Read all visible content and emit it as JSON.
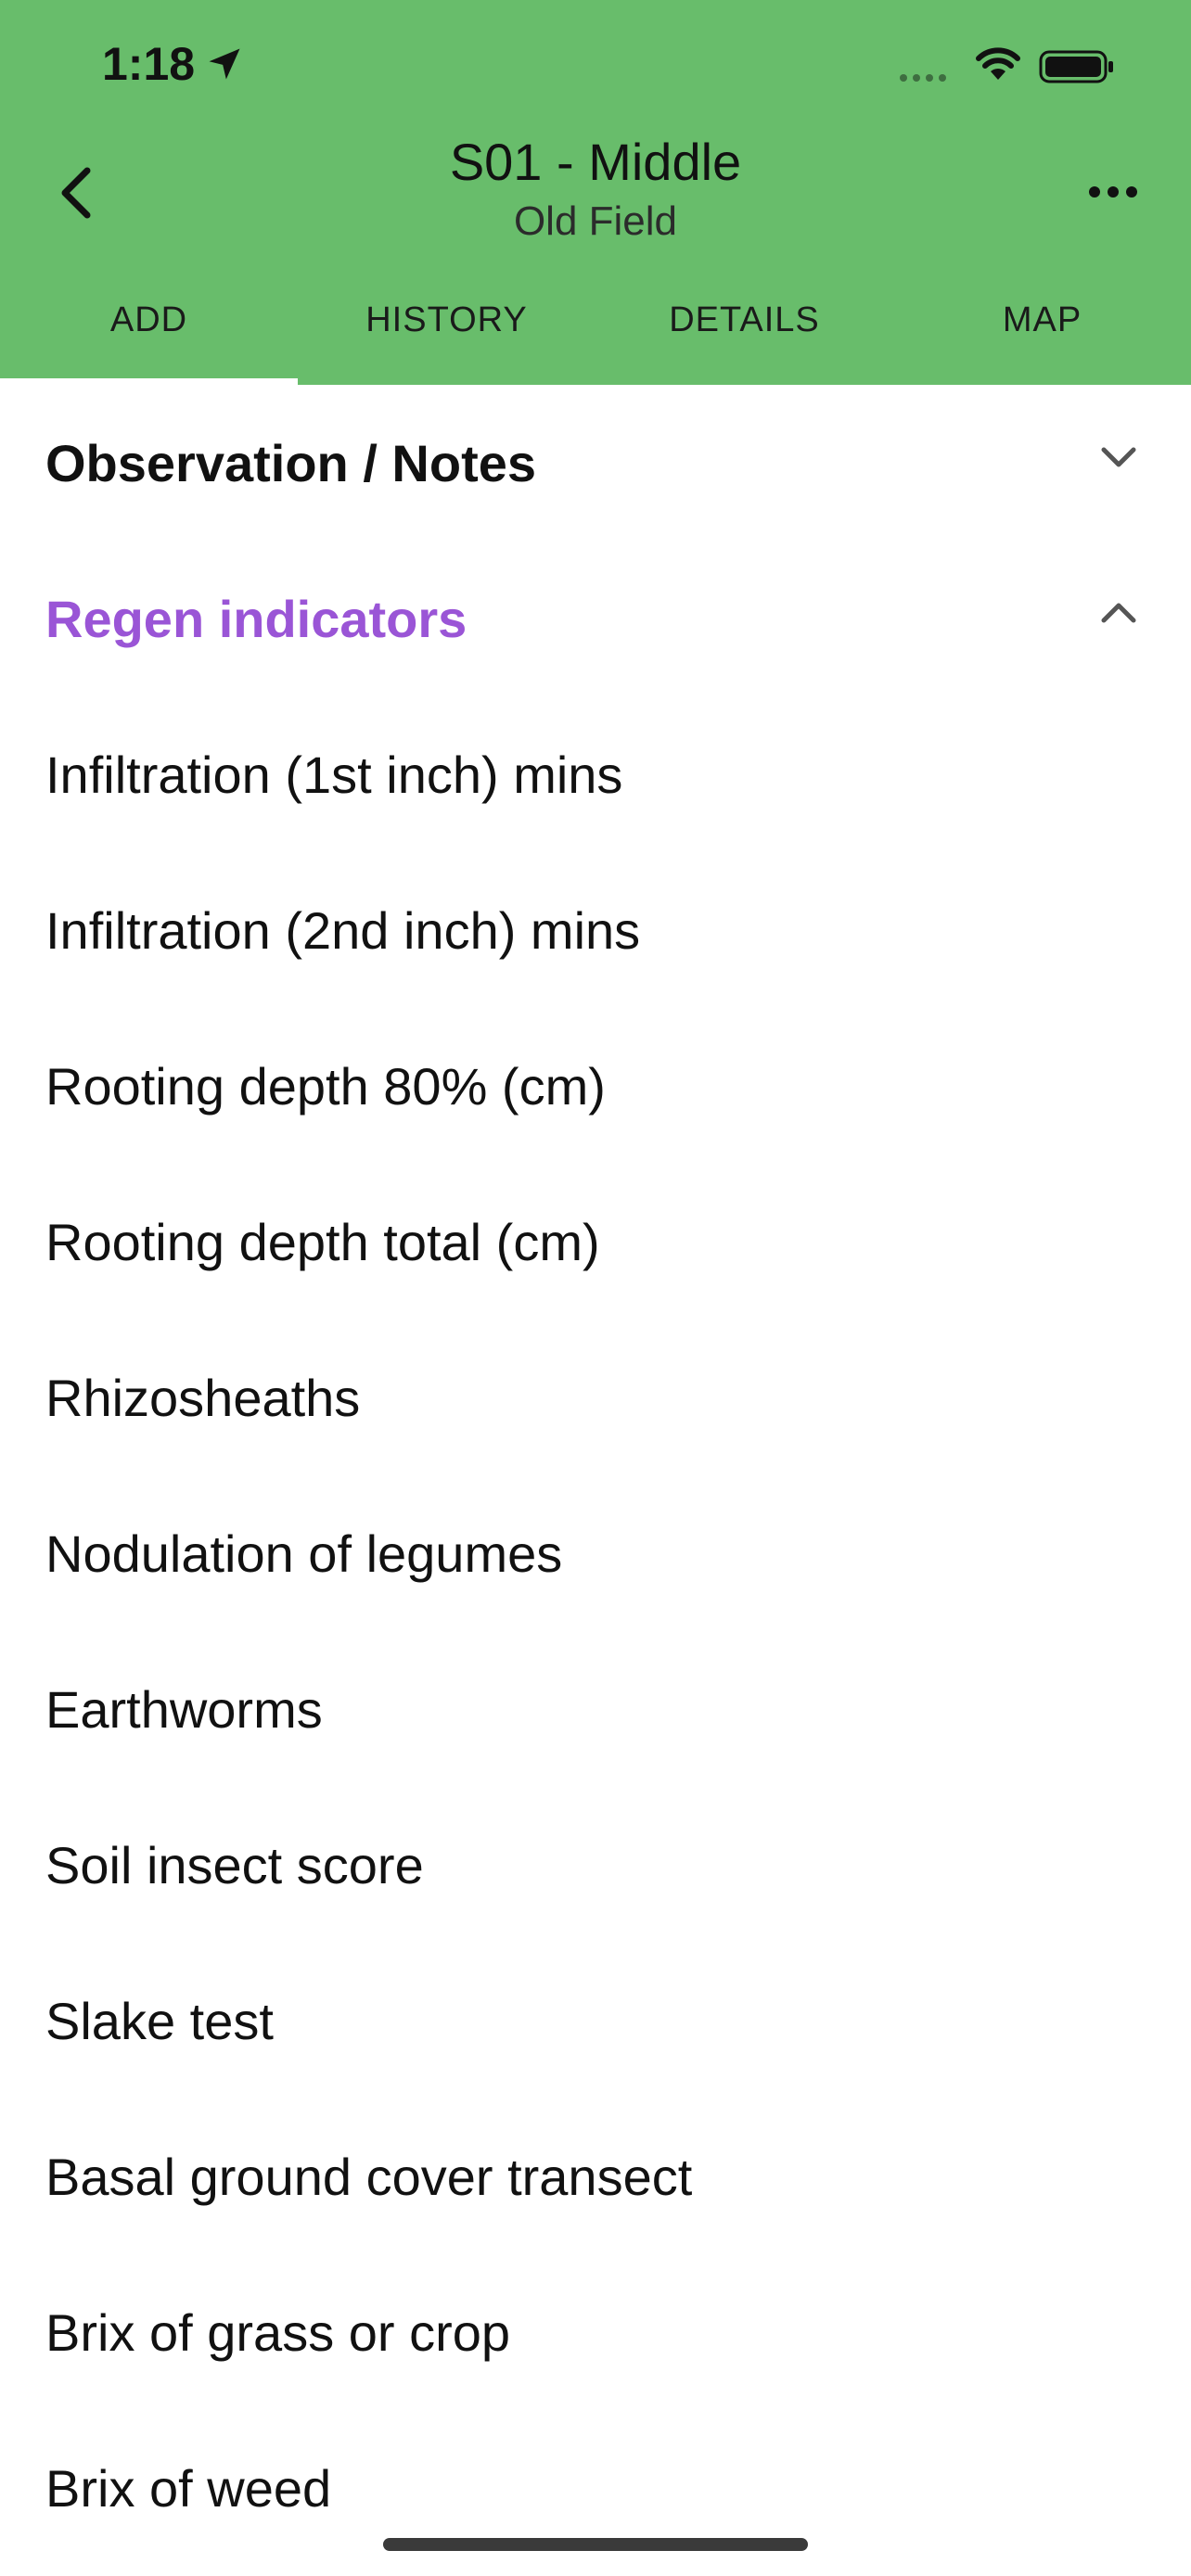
{
  "status_bar": {
    "time": "1:18"
  },
  "header": {
    "title": "S01 - Middle",
    "subtitle": "Old Field",
    "tabs": [
      {
        "label": "ADD",
        "active": true
      },
      {
        "label": "HISTORY",
        "active": false
      },
      {
        "label": "DETAILS",
        "active": false
      },
      {
        "label": "MAP",
        "active": false
      }
    ]
  },
  "sections": {
    "observation": {
      "label": "Observation / Notes",
      "expanded": false
    },
    "regen": {
      "label": "Regen indicators",
      "expanded": true,
      "color": "#9a55d6",
      "items": [
        "Infiltration (1st inch) mins",
        "Infiltration (2nd inch) mins",
        "Rooting depth 80% (cm)",
        "Rooting depth total (cm)",
        "Rhizosheaths",
        "Nodulation of legumes",
        "Earthworms",
        "Soil insect score",
        "Slake test",
        "Basal ground cover transect",
        "Brix of grass or crop",
        "Brix of weed"
      ]
    }
  },
  "colors": {
    "header_bg": "#68bd6b",
    "accent_purple": "#9a55d6"
  }
}
